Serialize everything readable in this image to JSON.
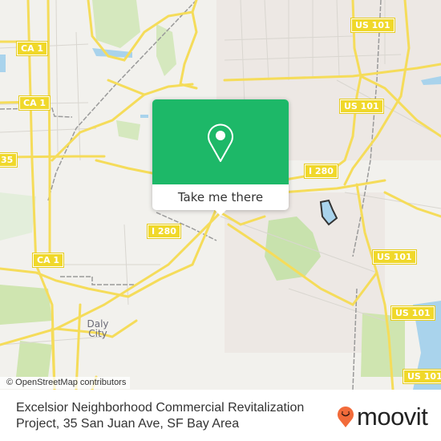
{
  "map": {
    "shields": [
      {
        "id": "ca1-top",
        "label": "CA 1"
      },
      {
        "id": "ca1-mid",
        "label": "CA 1"
      },
      {
        "id": "ca35",
        "label": "35"
      },
      {
        "id": "ca1-low",
        "label": "CA 1"
      },
      {
        "id": "us101-a",
        "label": "US 101"
      },
      {
        "id": "us101-b",
        "label": "US 101"
      },
      {
        "id": "us101-c",
        "label": "US 101"
      },
      {
        "id": "us101-d",
        "label": "US 101"
      },
      {
        "id": "us101-e",
        "label": "US 101"
      },
      {
        "id": "i280-a",
        "label": "I 280"
      },
      {
        "id": "i280-b",
        "label": "I 280"
      }
    ],
    "city_label": "Daly City",
    "attribution": "© OpenStreetMap contributors",
    "colors": {
      "background": "#f2f1ed",
      "road": "#f5dc5a",
      "park": "#cfe5b0",
      "water": "#a9d3ec",
      "popup": "#1db868"
    }
  },
  "popup": {
    "icon": "location-pin-icon",
    "button_label": "Take me there"
  },
  "footer": {
    "title": "Excelsior Neighborhood Commercial Revitalization Project, 35 San Juan Ave, SF Bay Area",
    "brand": "moovit",
    "brand_color": "#f26b3a"
  }
}
